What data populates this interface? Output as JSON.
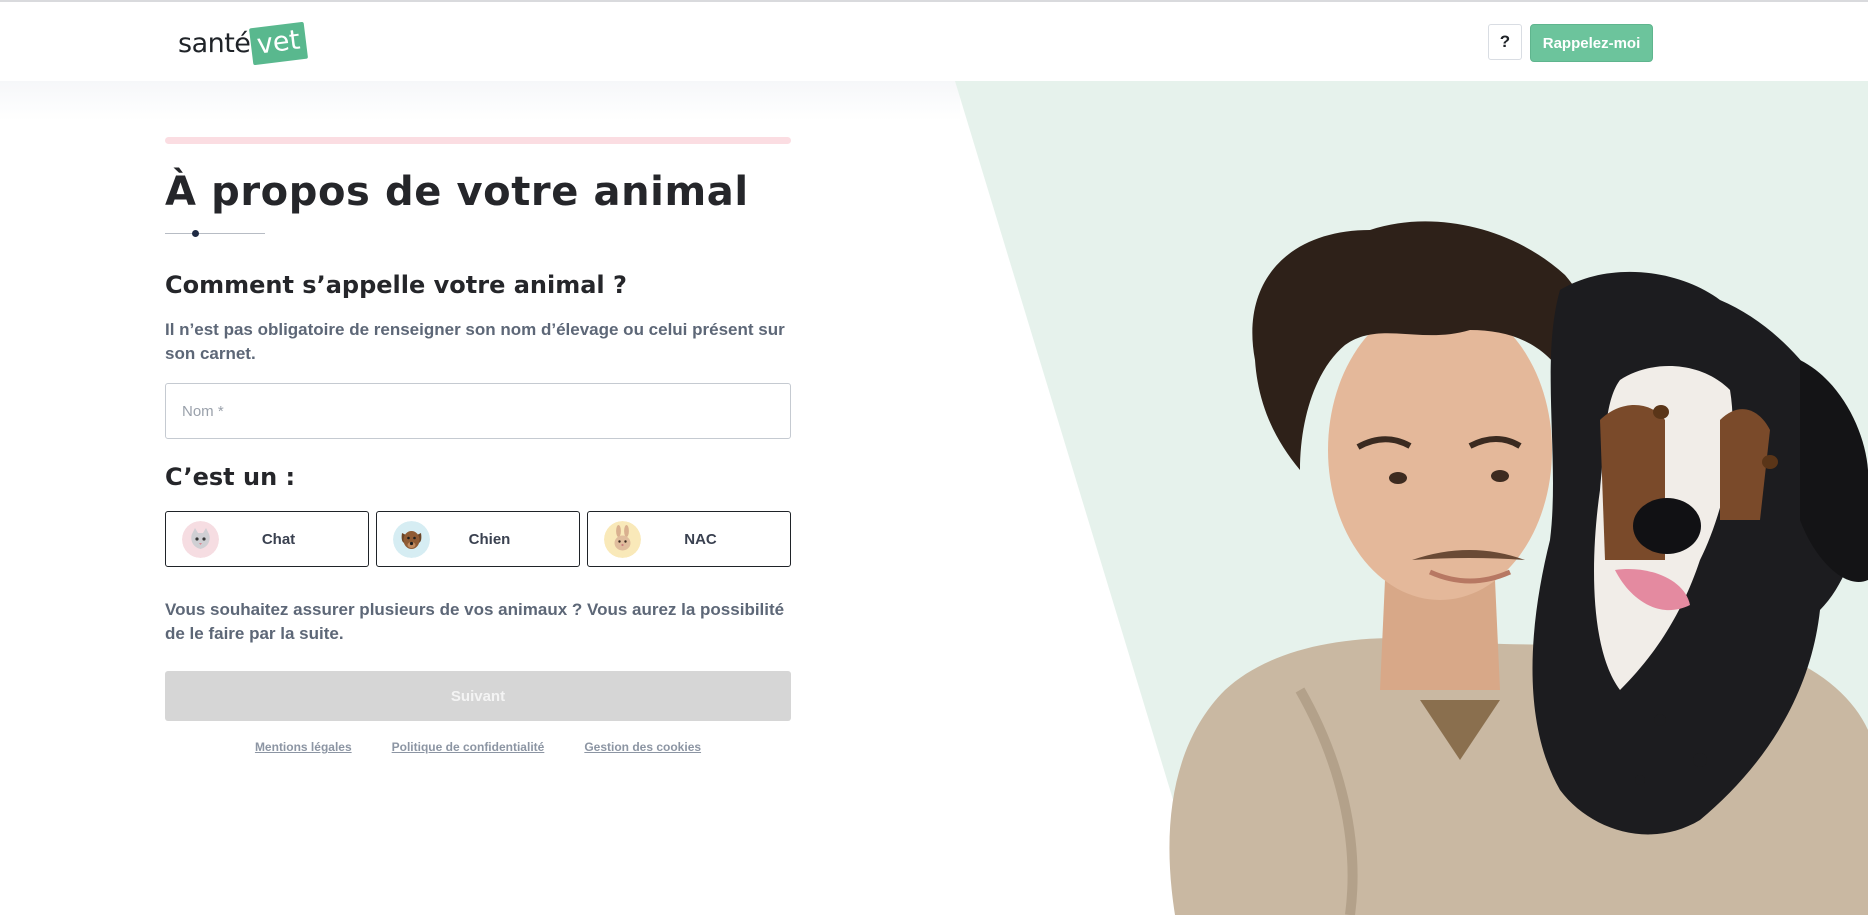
{
  "header": {
    "logo_text": "santé",
    "logo_badge": "vet",
    "help_label": "?",
    "callback_label": "Rappelez-moi"
  },
  "form": {
    "page_title": "À propos de votre animal",
    "question": "Comment s’appelle votre animal ?",
    "question_help": "Il n’est pas obligatoire de renseigner son nom d’élevage ou celui présent sur son carnet.",
    "name_input": {
      "placeholder": "Nom *",
      "value": ""
    },
    "type_title": "C’est un :",
    "types": [
      {
        "label": "Chat",
        "icon": "cat-icon"
      },
      {
        "label": "Chien",
        "icon": "dog-icon"
      },
      {
        "label": "NAC",
        "icon": "rabbit-icon"
      }
    ],
    "multi_note": "Vous souhaitez assurer plusieurs de vos animaux ? Vous aurez la possibilité de le faire par la suite.",
    "next_label": "Suivant"
  },
  "footer_links": {
    "legal": "Mentions légales",
    "privacy": "Politique de confidentialité",
    "cookies": "Gestion des cookies"
  },
  "colors": {
    "brand_green": "#59b88e",
    "button_green": "#6cc49c",
    "panel_mint": "#e6f2ec",
    "progress_pink": "#fbdde2",
    "disabled_grey": "#d6d6d6"
  }
}
